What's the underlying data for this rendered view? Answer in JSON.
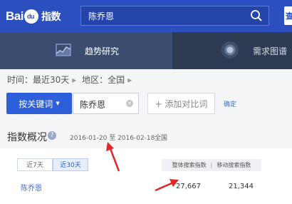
{
  "header": {
    "logo_text_1": "Bai",
    "logo_paw_text": "du",
    "logo_text_2": "指数",
    "search_value": "陈乔恩",
    "right_button_partial": "查"
  },
  "nav": {
    "tab_active": "趋势研究",
    "tab_other": "需求图谱"
  },
  "filters": {
    "time_label": "时间：",
    "time_value": "最近30天",
    "region_label": "地区：",
    "region_value": "全国"
  },
  "actions": {
    "keyword_button": "按关键词",
    "keyword_value": "陈乔恩",
    "add_compare": "+ 添加对比词",
    "confirm": "确定"
  },
  "overview": {
    "title": "指数概况",
    "date_start": "2016-01-20",
    "date_to": "至",
    "date_end": "2016-02-18",
    "region": "全国"
  },
  "panel": {
    "tabs": [
      "近7天",
      "近30天"
    ],
    "active_tab": 1,
    "col_overall": "整体搜索指数",
    "col_mobile": "移动搜索指数",
    "row_keyword": "陈乔恩",
    "overall_value": "27,667",
    "mobile_value": "21,344"
  },
  "colors": {
    "header_bg": "#2c4fbf",
    "nav_bg": "#2d3a52",
    "primary_button": "#2c5fd9",
    "annotation_arrow": "#e0282b"
  }
}
